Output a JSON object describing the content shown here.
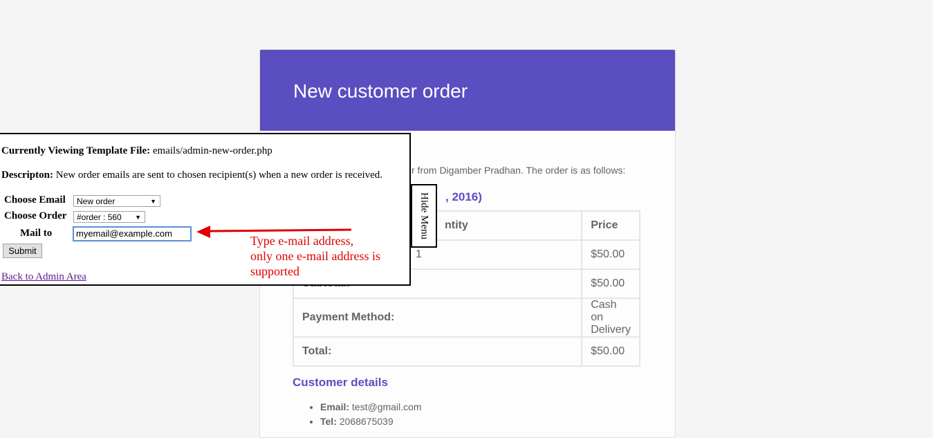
{
  "email": {
    "header_title": "New customer order",
    "intro": "r from Digamber Pradhan. The order is as follows:",
    "order_heading": ", 2016)",
    "table": {
      "headers": [
        "ntity",
        "Price"
      ],
      "rows": [
        {
          "label": "",
          "value_a": "1",
          "value_b": "$50.00"
        },
        {
          "label": "Subtotal:",
          "value": "$50.00"
        },
        {
          "label": "Payment Method:",
          "value": "Cash on Delivery"
        },
        {
          "label": "Total:",
          "value": "$50.00"
        }
      ]
    },
    "customer_heading": "Customer details",
    "details": [
      {
        "label": "Email:",
        "value": " test@gmail.com"
      },
      {
        "label": "Tel:",
        "value": " 2068675039"
      }
    ]
  },
  "panel": {
    "template_label": "Currently Viewing Template File:",
    "template_value": " emails/admin-new-order.php",
    "description_label": "Descripton:",
    "description_value": " New order emails are sent to chosen recipient(s) when a new order is received.",
    "choose_email_label": "Choose Email",
    "choose_email_value": "New order",
    "choose_order_label": "Choose Order",
    "choose_order_value": "#order : 560",
    "mail_to_label": "Mail to",
    "mail_to_value": "myemail@example.com",
    "submit_label": "Submit",
    "back_link": "Back to Admin Area"
  },
  "hide_menu_label": "Hide Menu",
  "annotation": {
    "text_line1": "Type e-mail address,",
    "text_line2": "only one e-mail address is",
    "text_line3": "supported",
    "color": "#e00000"
  },
  "icons": {
    "dropdown_arrow": "▼"
  }
}
